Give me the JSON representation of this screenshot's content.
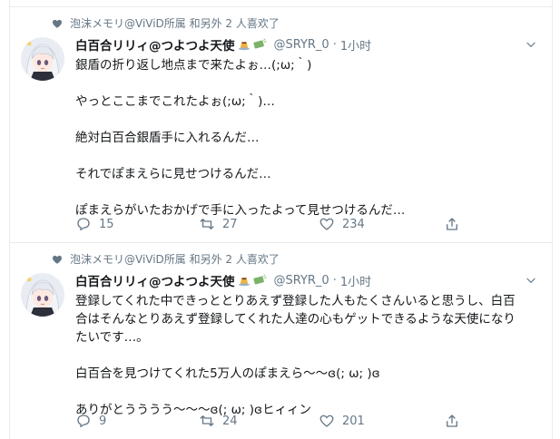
{
  "tweets": [
    {
      "social": "泡沫メモリ@ViViD所属 和另外 2 人喜欢了",
      "name": "白百合リリィ@つよつよ天使",
      "handle": "@SRYR_0",
      "time": "1小时",
      "lines": [
        "銀盾の折り返し地点まで来たよぉ…(;ω;｀)",
        "",
        "やっとここまでこれたよぉ(;ω;｀)…",
        "",
        "絶対白百合銀盾手に入れるんだ…",
        "",
        "それでぽまえらに見せつけるんだ…",
        "",
        "ぽまえらがいたおかげで手に入ったよって見せつけるんだ…"
      ],
      "replies": "15",
      "retweets": "27",
      "likes": "234"
    },
    {
      "social": "泡沫メモリ@ViViD所属 和另外 2 人喜欢了",
      "name": "白百合リリィ@つよつよ天使",
      "handle": "@SRYR_0",
      "time": "1小时",
      "lines": [
        "登録してくれた中できっととりあえず登録した人もたくさんいると思うし、白百",
        "合はそんなとりあえず登録してくれた人達の心もゲットできるような天使になり",
        "たいです…。",
        "",
        "白百合を見つけてくれた5万人のぽまえら～～ɞ(; ω; )ɞ",
        "",
        "ありがとうううう～～～ɞ(; ω; )ɞヒィィン"
      ],
      "replies": "9",
      "retweets": "24",
      "likes": "201"
    }
  ],
  "icons": {
    "social": "heart-icon",
    "menu": "chevron-down-icon",
    "reply": "reply-icon",
    "retweet": "retweet-icon",
    "like": "like-icon",
    "share": "share-icon",
    "name_emoji": [
      "pudding-emoji",
      "money-emoji"
    ]
  },
  "colors": {
    "text": "#14171a",
    "secondary": "#657786",
    "border": "#e6ecf0"
  }
}
